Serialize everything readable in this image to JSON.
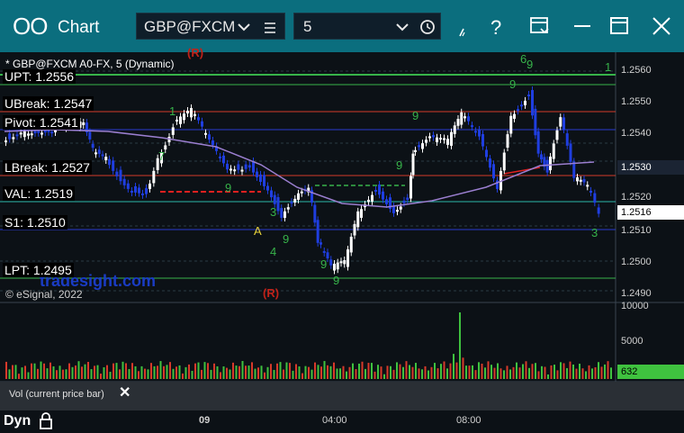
{
  "toolbar": {
    "app_title": "Chart",
    "symbol_value": "GBP@FXCM",
    "interval_value": "5"
  },
  "chart": {
    "legend": "* GBP@FXCM A0-FX, 5 (Dynamic)",
    "copyright": "© eSignal, 2022",
    "watermark": "tradesight.com",
    "marker_r_top": "(R)",
    "marker_r_bottom": "(R)",
    "marker_a": "A",
    "levels": [
      {
        "label": "UPT: 1.2556",
        "color": "#37b34a"
      },
      {
        "label": "UBreak: 1.2547",
        "color": "#d33b2a"
      },
      {
        "label": "Pivot: 1.2541",
        "color": "#2a3bd0"
      },
      {
        "label": "LBreak: 1.2527",
        "color": "#d33b2a"
      },
      {
        "label": "VAL: 1.2519",
        "color": "#2bb6a8"
      },
      {
        "label": "S1: 1.2510",
        "color": "#2a3bd0"
      },
      {
        "label": "LPT: 1.2495",
        "color": "#37b34a"
      }
    ],
    "price_ticks": [
      "1.2560",
      "1.2550",
      "1.2540",
      "1.2520",
      "1.2510",
      "1.2500",
      "1.2490"
    ],
    "last_price_badge": "1.2530",
    "current_price_badge": "1.2516",
    "volume_ticks": [
      "10000",
      "5000"
    ],
    "volume_badge": "632",
    "volume_study_label": "Vol (current price bar)",
    "time_ticks": [
      "09",
      "04:00",
      "08:00"
    ],
    "mode_label": "Dyn"
  },
  "colors": {
    "toolbar_bg": "#0b6e7e",
    "chart_bg": "#0c1116",
    "up_candle": "#ffffff",
    "down_candle": "#1f3ee0",
    "ma_line": "#9b7fd0",
    "volume_up": "#3fc23f",
    "volume_down": "#d83a2a",
    "volume_badge": "#3fc23f"
  },
  "icons": [
    "app-icon",
    "chevron-down-icon",
    "menu-icon",
    "clock-icon",
    "drawing-tool-icon",
    "help-icon",
    "template-icon",
    "minimize-icon",
    "maximize-icon",
    "close-icon",
    "lock-icon"
  ]
}
